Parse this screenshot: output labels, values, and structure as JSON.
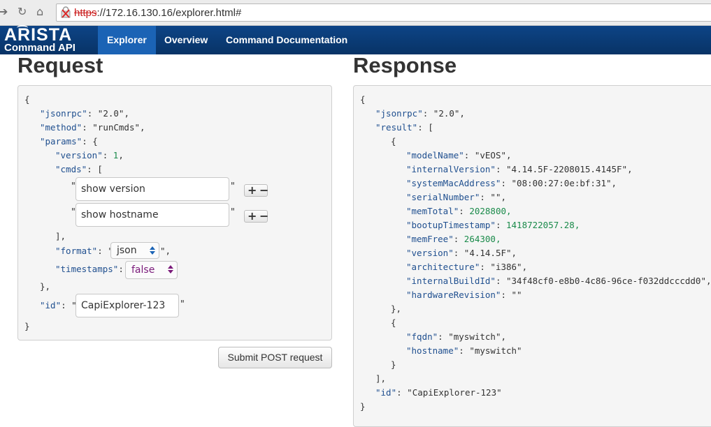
{
  "browser": {
    "url_scheme": "https",
    "url_rest": "://172.16.130.16/explorer.html#",
    "icons": [
      "back-icon",
      "reload-icon",
      "home-icon",
      "insecure-lock-icon"
    ]
  },
  "brand": {
    "line1": "ARISTA",
    "line2": "Command API"
  },
  "nav": {
    "items": [
      {
        "label": "Explorer",
        "active": true
      },
      {
        "label": "Overview",
        "active": false
      },
      {
        "label": "Command Documentation",
        "active": false
      }
    ]
  },
  "request": {
    "title": "Request",
    "open_brace": "{",
    "jsonrpc_key": "\"jsonrpc\"",
    "jsonrpc_val": "\"2.0\"",
    "method_key": "\"method\"",
    "method_val": "\"runCmds\"",
    "params_key": "\"params\"",
    "version_key": "\"version\"",
    "version_val": "1",
    "cmds_key": "\"cmds\"",
    "cmds": [
      "show version",
      "show hostname"
    ],
    "format_key": "\"format\"",
    "format_value": "json",
    "timestamps_key": "\"timestamps\"",
    "timestamps_value": "false",
    "id_key": "\"id\"",
    "id_value": "CapiExplorer-123",
    "close_brace": "}",
    "submit_label": "Submit POST request"
  },
  "response": {
    "title": "Response",
    "lines": [
      {
        "indent": 0,
        "key": "",
        "val": "{",
        "vt": "p"
      },
      {
        "indent": 1,
        "key": "\"jsonrpc\"",
        "val": "\"2.0\",",
        "vt": "s"
      },
      {
        "indent": 1,
        "key": "\"result\"",
        "val": "[",
        "vt": "p"
      },
      {
        "indent": 2,
        "key": "",
        "val": "{",
        "vt": "p"
      },
      {
        "indent": 3,
        "key": "\"modelName\"",
        "val": "\"vEOS\",",
        "vt": "s"
      },
      {
        "indent": 3,
        "key": "\"internalVersion\"",
        "val": "\"4.14.5F-2208015.4145F\",",
        "vt": "s"
      },
      {
        "indent": 3,
        "key": "\"systemMacAddress\"",
        "val": "\"08:00:27:0e:bf:31\",",
        "vt": "s"
      },
      {
        "indent": 3,
        "key": "\"serialNumber\"",
        "val": "\"\",",
        "vt": "s"
      },
      {
        "indent": 3,
        "key": "\"memTotal\"",
        "val": "2028800,",
        "vt": "n"
      },
      {
        "indent": 3,
        "key": "\"bootupTimestamp\"",
        "val": "1418722057.28,",
        "vt": "n"
      },
      {
        "indent": 3,
        "key": "\"memFree\"",
        "val": "264300,",
        "vt": "n"
      },
      {
        "indent": 3,
        "key": "\"version\"",
        "val": "\"4.14.5F\",",
        "vt": "s"
      },
      {
        "indent": 3,
        "key": "\"architecture\"",
        "val": "\"i386\",",
        "vt": "s"
      },
      {
        "indent": 3,
        "key": "\"internalBuildId\"",
        "val": "\"34f48cf0-e8b0-4c86-96ce-f032ddcccdd0\",",
        "vt": "s"
      },
      {
        "indent": 3,
        "key": "\"hardwareRevision\"",
        "val": "\"\"",
        "vt": "s"
      },
      {
        "indent": 2,
        "key": "",
        "val": "},",
        "vt": "p"
      },
      {
        "indent": 2,
        "key": "",
        "val": "{",
        "vt": "p"
      },
      {
        "indent": 3,
        "key": "\"fqdn\"",
        "val": "\"myswitch\",",
        "vt": "s"
      },
      {
        "indent": 3,
        "key": "\"hostname\"",
        "val": "\"myswitch\"",
        "vt": "s"
      },
      {
        "indent": 2,
        "key": "",
        "val": "}",
        "vt": "p"
      },
      {
        "indent": 1,
        "key": "",
        "val": "],",
        "vt": "p"
      },
      {
        "indent": 1,
        "key": "\"id\"",
        "val": "\"CapiExplorer-123\"",
        "vt": "s"
      },
      {
        "indent": 0,
        "key": "",
        "val": "}",
        "vt": "p"
      }
    ]
  },
  "colors": {
    "nav_bg": "#0a3d7a",
    "nav_active": "#1b63b5",
    "json_key": "#1f4f8f",
    "json_number": "#1a8a4a",
    "url_insecure": "#c91a1a"
  }
}
